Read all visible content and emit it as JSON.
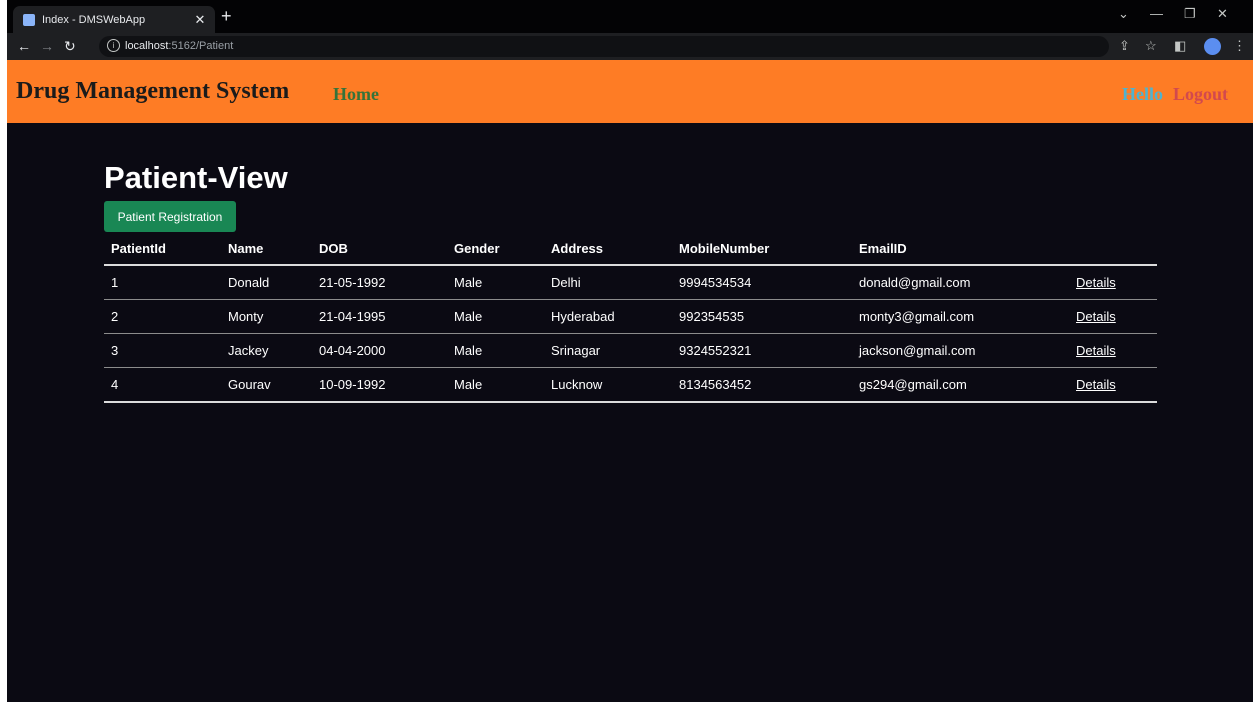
{
  "browser": {
    "tab_title": "Index - DMSWebApp",
    "url_host": "localhost",
    "url_path": ":5162/Patient"
  },
  "navbar": {
    "brand": "Drug Management System",
    "home": "Home",
    "hello": "Hello",
    "logout": "Logout",
    "colors": {
      "background": "#fe7c25",
      "home": "#35733a",
      "hello": "#4fb3cf",
      "logout": "#d2494e"
    }
  },
  "page": {
    "title": "Patient-View",
    "register_button": "Patient Registration",
    "register_button_color": "#198754"
  },
  "table": {
    "headers": [
      "PatientId",
      "Name",
      "DOB",
      "Gender",
      "Address",
      "MobileNumber",
      "EmailID",
      ""
    ],
    "rows": [
      [
        "1",
        "Donald",
        "21-05-1992",
        "Male",
        "Delhi",
        "9994534534",
        "donald@gmail.com",
        "Details"
      ],
      [
        "2",
        "Monty",
        "21-04-1995",
        "Male",
        "Hyderabad",
        "992354535",
        "monty3@gmail.com",
        "Details"
      ],
      [
        "3",
        "Jackey",
        "04-04-2000",
        "Male",
        "Srinagar",
        "9324552321",
        "jackson@gmail.com",
        "Details"
      ],
      [
        "4",
        "Gourav",
        "10-09-1992",
        "Male",
        "Lucknow",
        "8134563452",
        "gs294@gmail.com",
        "Details"
      ]
    ]
  }
}
